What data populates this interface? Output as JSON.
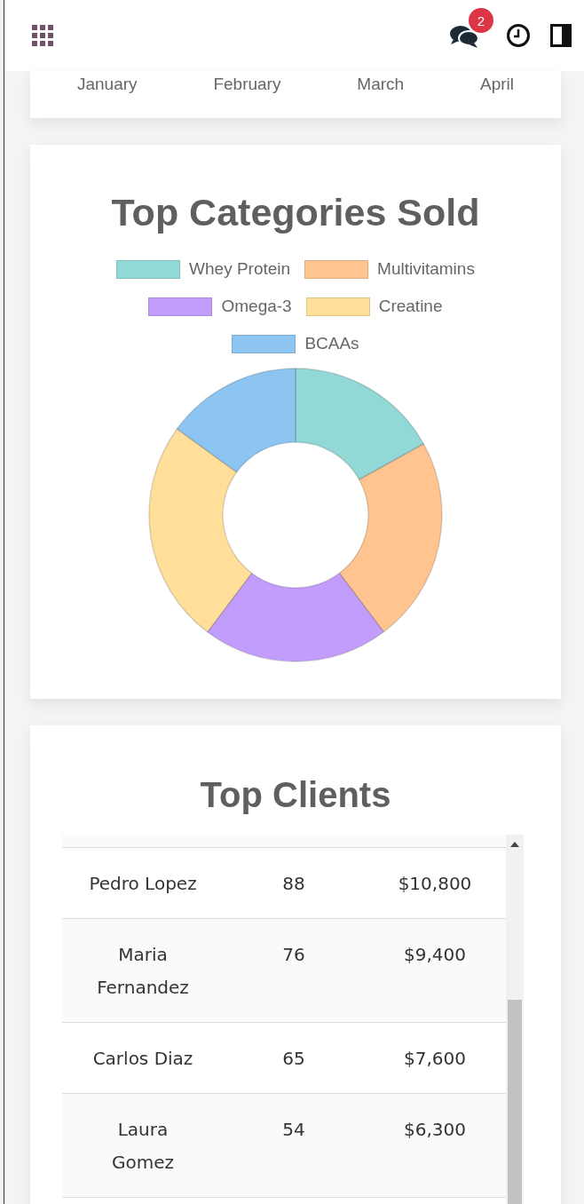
{
  "header": {
    "notification_count": "2"
  },
  "sales_chart": {
    "month_labels": [
      "January",
      "February",
      "March",
      "April"
    ]
  },
  "categories_card": {
    "title": "Top Categories Sold",
    "legend": [
      {
        "label": "Whey Protein",
        "color": "#91d8d6"
      },
      {
        "label": "Multivitamins",
        "color": "#ffc490"
      },
      {
        "label": "Omega-3",
        "color": "#c39dfb"
      },
      {
        "label": "Creatine",
        "color": "#ffdf9a"
      },
      {
        "label": "BCAAs",
        "color": "#8cc5f2"
      }
    ]
  },
  "clients_card": {
    "title": "Top Clients",
    "rows": [
      [
        "Pedro Lopez",
        "88",
        "$10,800"
      ],
      [
        "Maria Fernandez",
        "76",
        "$9,400"
      ],
      [
        "Carlos Diaz",
        "65",
        "$7,600"
      ],
      [
        "Laura Gomez",
        "54",
        "$6,300"
      ]
    ]
  }
}
